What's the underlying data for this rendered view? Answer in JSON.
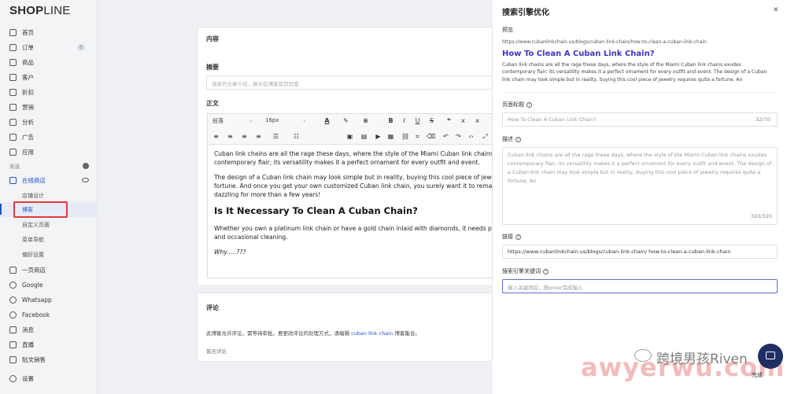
{
  "app": {
    "logo_bold": "SHOP",
    "logo_light": "LINE"
  },
  "sidebar": {
    "items": [
      {
        "label": "首页"
      },
      {
        "label": "订单",
        "badge": "0"
      },
      {
        "label": "商品"
      },
      {
        "label": "客户"
      },
      {
        "label": "折扣"
      },
      {
        "label": "营销"
      },
      {
        "label": "分析"
      },
      {
        "label": "广告"
      },
      {
        "label": "应用"
      }
    ],
    "channels_label": "渠道",
    "online_store": "在线商店",
    "sub_items": [
      {
        "label": "店铺设计"
      },
      {
        "label": "博客"
      },
      {
        "label": "自定义页面"
      },
      {
        "label": "菜单导航"
      },
      {
        "label": "偏好设置"
      }
    ],
    "bottom_items": [
      {
        "label": "一页商店"
      },
      {
        "label": "Google"
      },
      {
        "label": "Whatsapp"
      },
      {
        "label": "Facebook"
      },
      {
        "label": "消息"
      },
      {
        "label": "直播"
      },
      {
        "label": "贴文销售"
      },
      {
        "label": "设置"
      }
    ]
  },
  "main": {
    "content_title": "内容",
    "summary_label": "摘要",
    "summary_placeholder": "填单的文章介绍，展示在博客首页页面",
    "body_label": "正文",
    "toolbar": {
      "paragraph": "段落",
      "font_size": "16px"
    },
    "editor": {
      "p1": "Cuban link chains are all the rage these days, where the style of the Miami Cuban link chains e",
      "p1b": "contemporary flair; its versatility makes it a perfect ornament for every outfit and event.",
      "p2": "The design of a Cuban link chain may look simple but in reality, buying this cool piece of jewel",
      "p2b": "fortune. And once you get your own customized Cuban link chain, you surely want it to remain",
      "p2c": "dazzling for more than a few years!",
      "h2": "Is It Necessary To Clean A Cuban Chain?",
      "p3": "Whether you own a platinum link chain or have a gold chain inlaid with diamonds, it needs prop",
      "p3b": "and occasional cleaning.",
      "p4": "Why.....???"
    },
    "comments_title": "评论",
    "comments_note_pre": "此博客允许评论，需等待审批。要更改评论的处理方式，请编辑",
    "comments_note_link": "cuban link chain",
    "comments_note_post": "博客集合。",
    "no_comments": "暂无评论"
  },
  "seo": {
    "title": "搜索引擎优化",
    "close": "✕",
    "preview_label": "预览",
    "preview_url": "https://www.cubanlinkchain.us/blogs/cuban-link-chain/how-to-clean-a-cuban-link-chain",
    "preview_title": "How To Clean A Cuban Link Chain?",
    "preview_desc": "Cuban link chains are all the rage these days, where the style of the Miami Cuban link chains exudes contemporary flair; its versatility makes it a perfect ornament for every outfit and event. The design of a Cuban link chain may look simple but in reality, buying this cool piece of jewelry requires quite a fortune. An",
    "page_title_label": "页面标题",
    "page_title_placeholder": "How To Clean A Cuban Link Chain?",
    "page_title_count": "32/70",
    "desc_label": "描述",
    "desc_placeholder": "Cuban link chains are all the rage these days, where the style of the Miami Cuban link chains exudes contemporary flair; its versatility makes it a perfect ornament for every outfit and event. The design of a Cuban link chain may look simple but in reality, buying this cool piece of jewelry requires quite a fortune. An",
    "desc_count": "320/320",
    "link_label": "链接",
    "link_prefix": "https://www.cubanlinkchain.us/blogs/cuban-link-chain/",
    "link_slug": "how-to-clean-a-cuban-link-chain",
    "keywords_label": "搜索引擎关键词",
    "keywords_placeholder": "输入关键词后，按enter完成输入",
    "done": "完成"
  },
  "watermark": {
    "text": "跨境男孩Riven",
    "url": "awyerwu.com"
  }
}
